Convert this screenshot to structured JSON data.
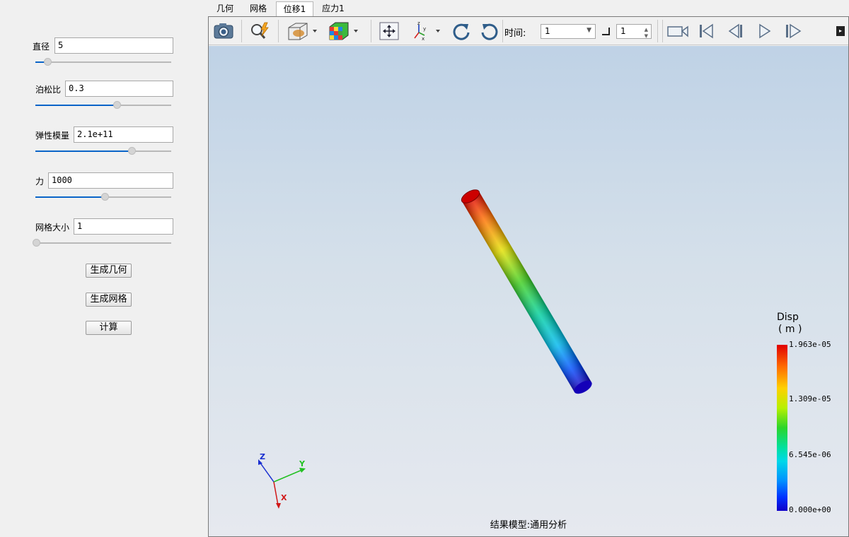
{
  "params": {
    "diameter": {
      "label": "直径",
      "value": "5",
      "slider": 0.09
    },
    "poisson": {
      "label": "泊松比",
      "value": "0.3",
      "slider": 0.6
    },
    "modulus": {
      "label": "弹性模量",
      "value": "2.1e+11",
      "slider": 0.71
    },
    "force": {
      "label": "力",
      "value": "1000",
      "slider": 0.51
    },
    "mesh": {
      "label": "网格大小",
      "value": "1",
      "slider": 0.0
    }
  },
  "buttons": {
    "geometry": "生成几何",
    "mesh": "生成网格",
    "compute": "计算"
  },
  "tabs": [
    {
      "label": "几何",
      "active": false
    },
    {
      "label": "网格",
      "active": false
    },
    {
      "label": "位移1",
      "active": true
    },
    {
      "label": "应力1",
      "active": false
    }
  ],
  "toolbar": {
    "time_label": "时间:",
    "time_select": "1",
    "step_value": "1",
    "icons": [
      "camera-icon",
      "zoom-icon",
      "section-view-icon",
      "color-cube-icon",
      "fit-view-icon",
      "axes-icon",
      "rotate-cw-icon",
      "rotate-ccw-icon",
      "record-video-icon",
      "first-frame-icon",
      "prev-frame-icon",
      "play-icon",
      "next-frame-icon"
    ]
  },
  "legend": {
    "title": "Disp",
    "unit": "( m )",
    "ticks": [
      "1.963e-05",
      "1.309e-05",
      "6.545e-06",
      "0.000e+00"
    ]
  },
  "triad": {
    "x": "X",
    "y": "Y",
    "z": "Z"
  },
  "status": "结果模型:通用分析",
  "colors": {
    "accent": "#0a64c8",
    "max": "#e00000",
    "min": "#1000c8"
  }
}
